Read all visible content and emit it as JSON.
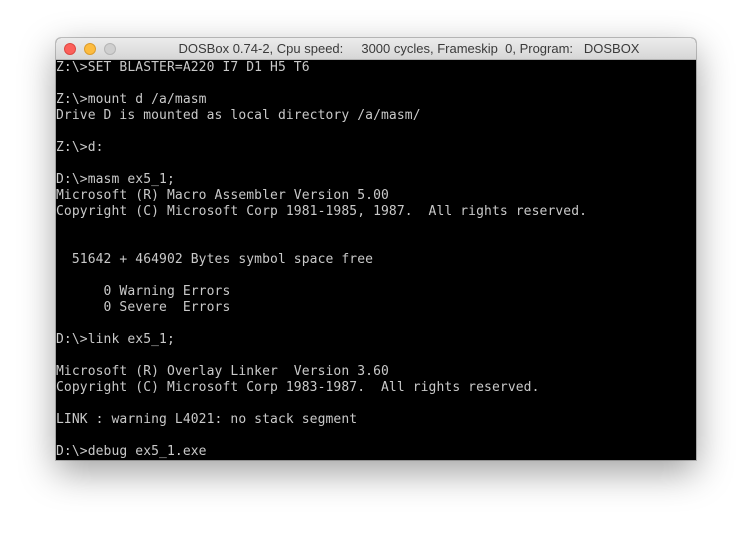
{
  "window": {
    "title": "DOSBox 0.74-2, Cpu speed:     3000 cycles, Frameskip  0, Program:   DOSBOX"
  },
  "terminal": {
    "lines": [
      "Z:\\>SET BLASTER=A220 I7 D1 H5 T6",
      "",
      "Z:\\>mount d /a/masm",
      "Drive D is mounted as local directory /a/masm/",
      "",
      "Z:\\>d:",
      "",
      "D:\\>masm ex5_1;",
      "Microsoft (R) Macro Assembler Version 5.00",
      "Copyright (C) Microsoft Corp 1981-1985, 1987.  All rights reserved.",
      "",
      "",
      "  51642 + 464902 Bytes symbol space free",
      "",
      "      0 Warning Errors",
      "      0 Severe  Errors",
      "",
      "D:\\>link ex5_1;",
      "",
      "Microsoft (R) Overlay Linker  Version 3.60",
      "Copyright (C) Microsoft Corp 1983-1987.  All rights reserved.",
      "",
      "LINK : warning L4021: no stack segment",
      "",
      "D:\\>debug ex5_1.exe"
    ]
  }
}
